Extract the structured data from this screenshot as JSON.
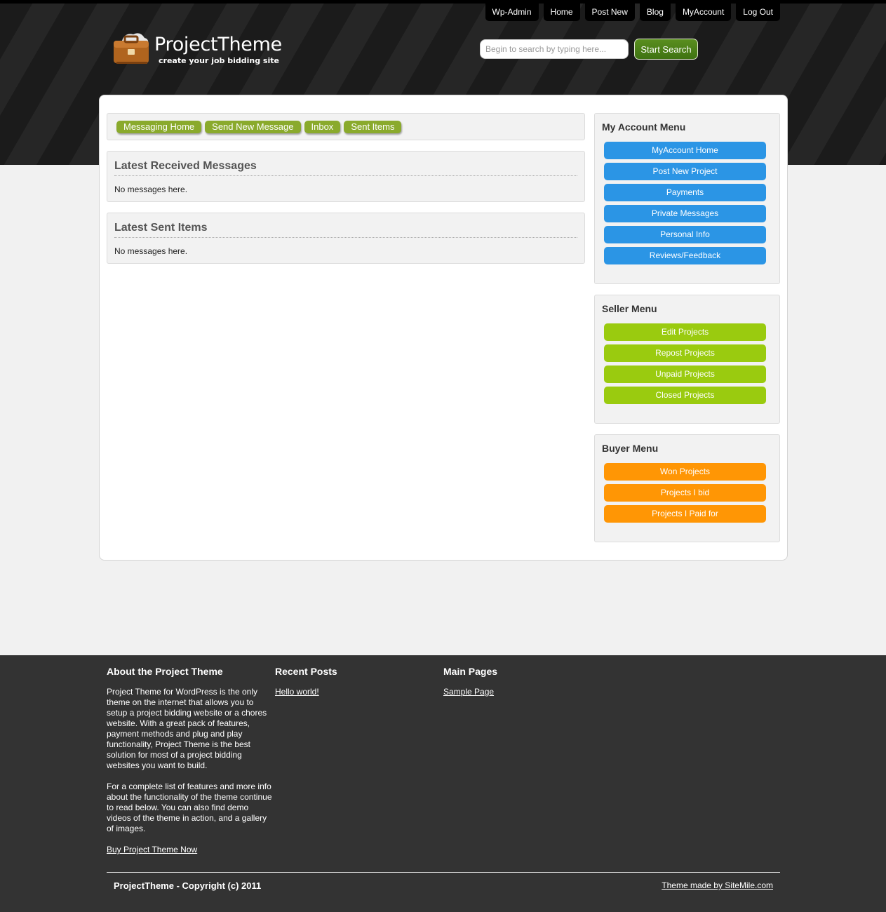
{
  "top_nav": [
    "Wp-Admin",
    "Home",
    "Post New",
    "Blog",
    "MyAccount",
    "Log Out"
  ],
  "logo": {
    "title": "ProjectTheme",
    "tagline": "create your job bidding site"
  },
  "search": {
    "placeholder": "Begin to search by typing here...",
    "button_label": "Start Search"
  },
  "message_tabs": [
    "Messaging Home",
    "Send New Message",
    "Inbox",
    "Sent Items"
  ],
  "received": {
    "title": "Latest Received Messages",
    "empty_text": "No messages here."
  },
  "sent": {
    "title": "Latest Sent Items",
    "empty_text": "No messages here."
  },
  "account_menu": {
    "title": "My Account Menu",
    "items": [
      "MyAccount Home",
      "Post New Project",
      "Payments",
      "Private Messages",
      "Personal Info",
      "Reviews/Feedback"
    ]
  },
  "seller_menu": {
    "title": "Seller Menu",
    "items": [
      "Edit Projects",
      "Repost Projects",
      "Unpaid Projects",
      "Closed Projects"
    ]
  },
  "buyer_menu": {
    "title": "Buyer Menu",
    "items": [
      "Won Projects",
      "Projects I bid",
      "Projects I Paid for"
    ]
  },
  "footer": {
    "about": {
      "title": "About the Project Theme",
      "paragraph1": "Project Theme for WordPress is the only theme on the internet that allows you to setup a project bidding website or a chores website. With a great pack of features, payment methods and plug and play functionality, Project Theme is the best solution for most of a project bidding websites you want to build.",
      "paragraph2": "For a complete list of features and more info about the functionality of the theme continue to read below. You can also find demo videos of the theme in action, and a gallery of images.",
      "link": "Buy Project Theme Now"
    },
    "recent_posts": {
      "title": "Recent Posts",
      "link": "Hello world!"
    },
    "main_pages": {
      "title": "Main Pages",
      "link": "Sample Page"
    },
    "copyright": "ProjectTheme - Copyright (c) 2011",
    "credit": "Theme made by SiteMile.com"
  },
  "colors": {
    "account_button": "#2b95e5",
    "seller_button": "#9acb0f",
    "buyer_button": "#ff9605",
    "tab_button": "#8aaa2c"
  }
}
